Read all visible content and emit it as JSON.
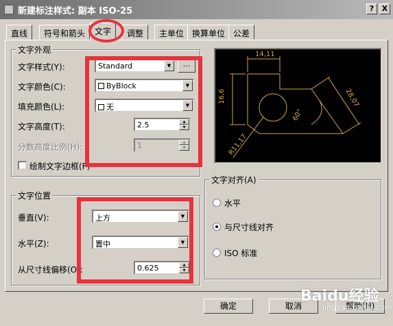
{
  "window": {
    "title": "新建标注样式: 副本 ISO-25",
    "help_btn": "?",
    "close_btn": "X"
  },
  "tabs": [
    {
      "label": "直线"
    },
    {
      "label": "符号和箭头"
    },
    {
      "label": "文字"
    },
    {
      "label": "调整"
    },
    {
      "label": "主单位"
    },
    {
      "label": "换算单位"
    },
    {
      "label": "公差"
    }
  ],
  "text_appearance": {
    "legend": "文字外观",
    "style_label": "文字样式(Y):",
    "style_value": "Standard",
    "browse_label": "...",
    "color_label": "文字颜色(C):",
    "color_value": "ByBlock",
    "fill_label": "填充颜色(L):",
    "fill_value": "无",
    "height_label": "文字高度(T):",
    "height_value": "2.5",
    "fraction_label": "分数高度比例(H):",
    "fraction_value": "1",
    "frame_label": "绘制文字边框(F)"
  },
  "text_placement": {
    "legend": "文字位置",
    "vertical_label": "垂直(V):",
    "vertical_value": "上方",
    "horizontal_label": "水平(Z):",
    "horizontal_value": "置中",
    "offset_label": "从尺寸线偏移(O):",
    "offset_value": "0.625"
  },
  "text_alignment": {
    "legend": "文字对齐(A)",
    "options": [
      {
        "label": "水平",
        "selected": false
      },
      {
        "label": "与尺寸线对齐",
        "selected": true
      },
      {
        "label": "ISO 标准",
        "selected": false
      }
    ]
  },
  "preview": {
    "dim_top": "14,11",
    "dim_left": "16,6",
    "dim_right": "28,07",
    "dim_angle": "60°",
    "dim_radius": "R11,17",
    "line_color": "#d4a84c"
  },
  "buttons": {
    "ok": "确定",
    "cancel": "取消",
    "help": "帮助(H)"
  },
  "watermark": {
    "main": "Baidu经验",
    "sub": "jingyan.baidu.com"
  },
  "colors": {
    "highlight": "#e8323c",
    "dialog_bg": "#d4d0c8"
  }
}
